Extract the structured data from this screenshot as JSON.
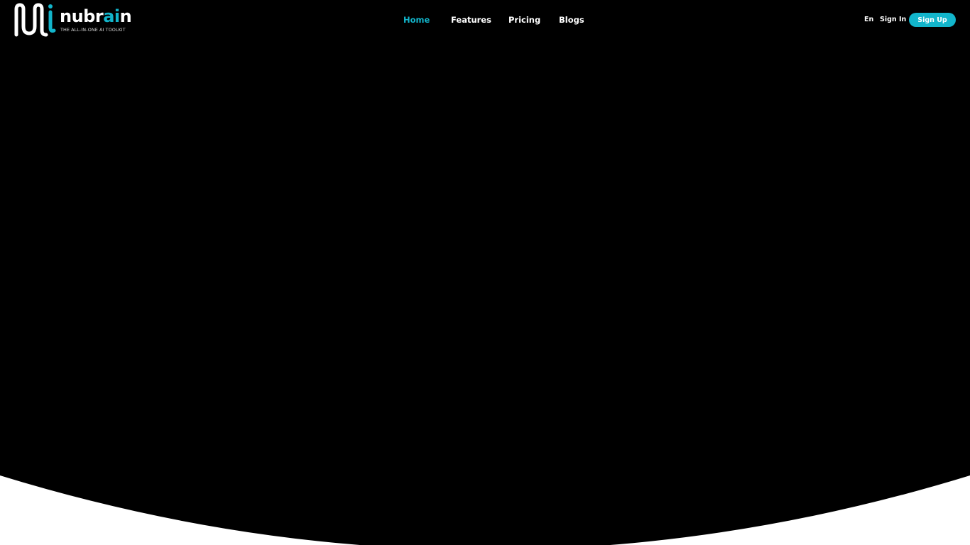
{
  "brand": {
    "name_main": "nubr",
    "name_accent": "ai",
    "name_end": "n",
    "tagline": "THE ALL-IN-ONE AI TOOLKIT",
    "accent_color": "#12b5cb"
  },
  "nav": {
    "items": [
      {
        "label": "Home",
        "active": true
      },
      {
        "label": "Features",
        "active": false
      },
      {
        "label": "Pricing",
        "active": false
      },
      {
        "label": "Blogs",
        "active": false
      }
    ]
  },
  "header_actions": {
    "language": "En",
    "sign_in": "Sign In",
    "sign_up": "Sign Up"
  },
  "colors": {
    "hero_background": "#000000",
    "page_background": "#ffffff",
    "accent": "#12b5cb"
  },
  "icons": {
    "logo": "nubrain-wave-logo-icon"
  }
}
